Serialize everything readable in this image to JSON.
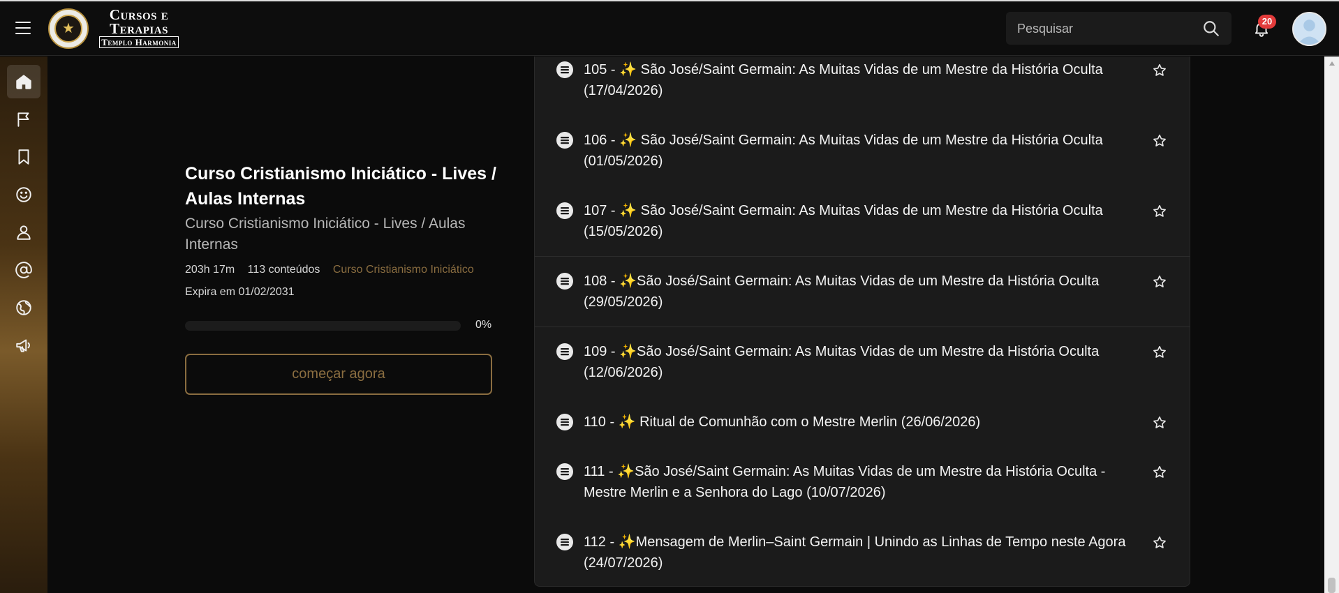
{
  "header": {
    "logo": {
      "line1": "Cursos e",
      "line2": "Terapias",
      "line3": "Templo Harmonia"
    },
    "search": {
      "placeholder": "Pesquisar"
    },
    "notifications": {
      "count": "20"
    }
  },
  "sidebar": {
    "items": [
      {
        "icon": "home-icon",
        "active": true
      },
      {
        "icon": "flag-icon"
      },
      {
        "icon": "bookmark-icon"
      },
      {
        "icon": "smile-icon"
      },
      {
        "icon": "user-icon"
      },
      {
        "icon": "at-icon"
      },
      {
        "icon": "globe-icon"
      },
      {
        "icon": "megaphone-icon"
      }
    ]
  },
  "course": {
    "title": "Curso Cristianismo Iniciático - Lives / Aulas Internas",
    "subtitle": "Curso Cristianismo Iniciático - Lives / Aulas Internas",
    "duration": "203h 17m",
    "contents": "113 conteúdos",
    "category": "Curso Cristianismo Iniciático",
    "expiry": "Expira em 01/02/2031",
    "progress": 0,
    "progress_label": "0%",
    "cta": "começar agora"
  },
  "lessons": [
    {
      "title": "105 - ✨ São José/Saint Germain: As Muitas Vidas de um Mestre da História Oculta (17/04/2026)"
    },
    {
      "title": "106 - ✨ São José/Saint Germain: As Muitas Vidas de um Mestre da História Oculta (01/05/2026)"
    },
    {
      "title": "107 - ✨ São José/Saint Germain: As Muitas Vidas de um Mestre da História Oculta (15/05/2026)"
    },
    {
      "title": "108 - ✨São José/Saint Germain: As Muitas Vidas de um Mestre da História Oculta (29/05/2026)"
    },
    {
      "title": "109 - ✨São José/Saint Germain: As Muitas Vidas de um Mestre da História Oculta (12/06/2026)"
    },
    {
      "title": "110 - ✨ Ritual de Comunhão com o Mestre Merlin (26/06/2026)"
    },
    {
      "title": "111 - ✨São José/Saint Germain: As Muitas Vidas de um Mestre da História Oculta - Mestre Merlin e a Senhora do Lago (10/07/2026)"
    },
    {
      "title": "112 - ✨Mensagem de Merlin–Saint Germain | Unindo as Linhas de Tempo neste Agora (24/07/2026)"
    }
  ],
  "colors": {
    "accent": "#8a6d40",
    "background": "#0b0b0b",
    "panel": "#1b1b1b",
    "badge": "#e33b3b"
  }
}
